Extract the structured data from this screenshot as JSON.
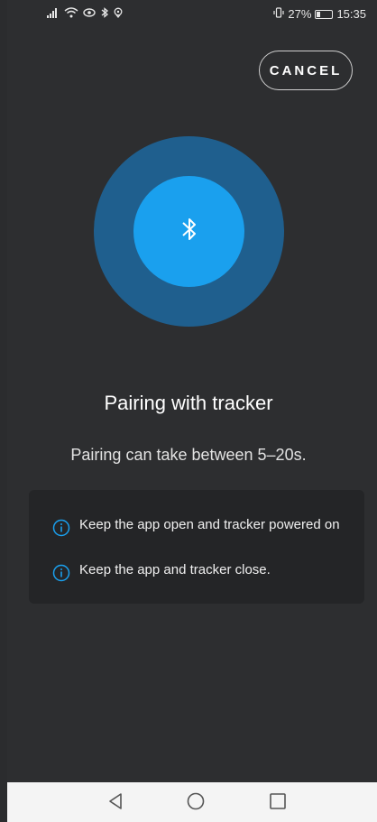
{
  "status_bar": {
    "battery_percent": "27%",
    "battery_level": 0.27,
    "time": "15:35",
    "left_icons": [
      "signal-icon",
      "wifi-icon",
      "eye-icon",
      "bluetooth-icon",
      "location-icon"
    ],
    "right_icons": [
      "vibrate-icon",
      "battery-icon"
    ]
  },
  "header": {
    "cancel_label": "CANCEL"
  },
  "pairing": {
    "icon": "bluetooth-icon",
    "title": "Pairing with tracker",
    "subtitle": "Pairing can take between 5–20s."
  },
  "tips": [
    {
      "icon": "info-icon",
      "text": "Keep the app open and tracker powered on"
    },
    {
      "icon": "info-icon",
      "text": "Keep the app and tracker close."
    }
  ],
  "colors": {
    "background": "#2d2e30",
    "pulse_outer": "#1f5f8e",
    "pulse_inner": "#1aa0ee",
    "accent": "#1aa0ee",
    "card": "#242527"
  },
  "nav": {
    "buttons": [
      "back-icon",
      "home-icon",
      "recents-icon"
    ]
  }
}
